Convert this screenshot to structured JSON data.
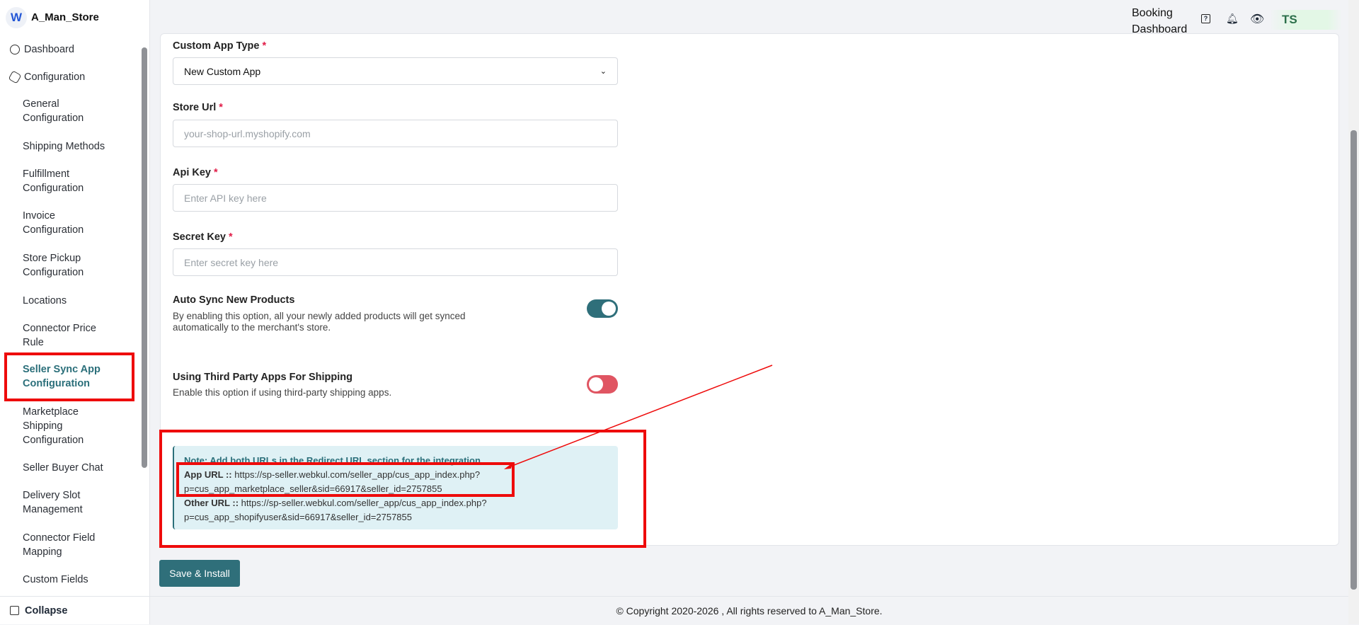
{
  "sidebar": {
    "brand": "A_Man_Store",
    "logo": "W",
    "dashboard": "Dashboard",
    "configuration": "Configuration",
    "items": [
      {
        "l1": "General",
        "l2": "Configuration"
      },
      {
        "l1": "Shipping Methods"
      },
      {
        "l1": "Fulfillment",
        "l2": "Configuration"
      },
      {
        "l1": "Invoice",
        "l2": "Configuration"
      },
      {
        "l1": "Store Pickup",
        "l2": "Configuration"
      },
      {
        "l1": "Locations"
      },
      {
        "l1": "Connector Price",
        "l2": "Rule"
      },
      {
        "l1": "Seller Sync App",
        "l2": "Configuration"
      },
      {
        "l1": "Marketplace",
        "l2": "Shipping",
        "l3": "Configuration"
      },
      {
        "l1": "Seller Buyer Chat"
      },
      {
        "l1": "Delivery Slot",
        "l2": "Management"
      },
      {
        "l1": "Connector Field",
        "l2": "Mapping"
      },
      {
        "l1": "Custom Fields"
      }
    ],
    "collapse": "Collapse"
  },
  "header": {
    "booking1": "Booking",
    "booking2": "Dashboard",
    "avatar": "TS"
  },
  "form": {
    "app_type_label": "Custom App Type",
    "app_type_value": "New Custom App",
    "store_url_label": "Store Url",
    "store_url_placeholder": "your-shop-url.myshopify.com",
    "api_key_label": "Api Key",
    "api_key_placeholder": "Enter API key here",
    "secret_key_label": "Secret Key",
    "secret_key_placeholder": "Enter secret key here",
    "auto_sync_title": "Auto Sync New Products",
    "auto_sync_desc": "By enabling this option, all your newly added products will get synced automatically to the merchant's store.",
    "auto_sync_on": true,
    "third_party_title": "Using Third Party Apps For Shipping",
    "third_party_desc": "Enable this option if using third-party shipping apps.",
    "third_party_on": false,
    "req": "*"
  },
  "note": {
    "text": "Note: Add both URLs in the Redirect URL section for the integration",
    "app_label": "App URL ::",
    "app_url1": "https://sp-seller.webkul.com/seller_app/cus_app_index.php?",
    "app_url2": "p=cus_app_marketplace_seller&sid=66917&seller_id=2757855",
    "other_label": "Other URL ::",
    "other_url1": "https://sp-seller.webkul.com/seller_app/cus_app_index.php?",
    "other_url2": "p=cus_app_shopifyuser&sid=66917&seller_id=2757855"
  },
  "save": "Save & Install",
  "footer": "© Copyright 2020-2026 , All rights reserved to A_Man_Store.",
  "colors": {
    "accent": "#2f6f7a",
    "toggle_on": "#2f6f7a",
    "toggle_off": "#e05562",
    "annotation": "#ee0b0b"
  }
}
